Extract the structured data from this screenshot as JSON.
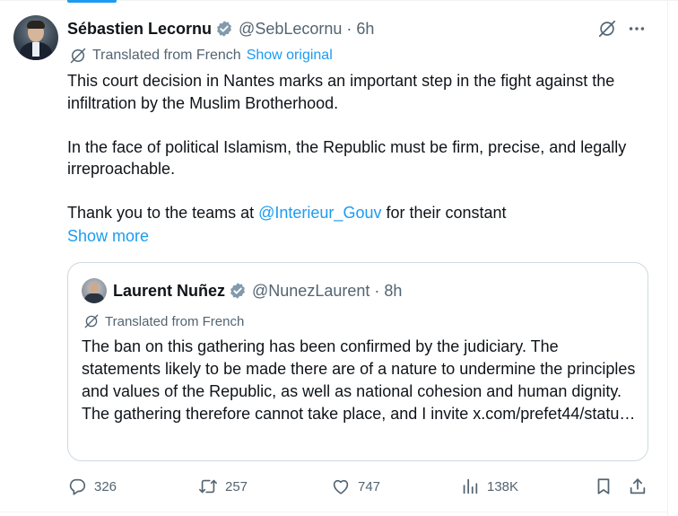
{
  "post": {
    "author_name": "Sébastien Lecornu",
    "handle": "@SebLecornu",
    "separator": "·",
    "time": "6h",
    "translation_note": "Translated from French",
    "show_original": "Show original",
    "paragraphs": [
      "This court decision in Nantes marks an important step in the fight against the infiltration by the Muslim Brotherhood.",
      "In the face of political Islamism, the Republic must be firm, precise, and legally irreproachable."
    ],
    "thanks_prefix": "Thank you to the teams at ",
    "mention": "@Interieur_Gouv",
    "thanks_suffix": " for their constant",
    "show_more": "Show more"
  },
  "quote": {
    "author_name": "Laurent Nuñez",
    "handle": "@NunezLaurent",
    "separator": "·",
    "time": "8h",
    "translation_note": "Translated from French",
    "text": "The ban on this gathering has been confirmed by the judiciary. The statements likely to be made there are of a nature to undermine the principles and values of the Republic, as well as national cohesion and human dignity. The gathering therefore cannot take place, and I invite x.com/prefet44/statu…"
  },
  "actions": {
    "replies": "326",
    "reposts": "257",
    "likes": "747",
    "views": "138K"
  },
  "icons": [
    "verified-badge-icon",
    "translate-off-icon",
    "more-icon",
    "globe-icon",
    "reply-icon",
    "repost-icon",
    "like-icon",
    "views-icon",
    "bookmark-icon",
    "share-icon"
  ],
  "colors": {
    "accent": "#1d9bf0",
    "text_primary": "#0f1419",
    "text_secondary": "#536471",
    "border": "#cfd9de"
  }
}
